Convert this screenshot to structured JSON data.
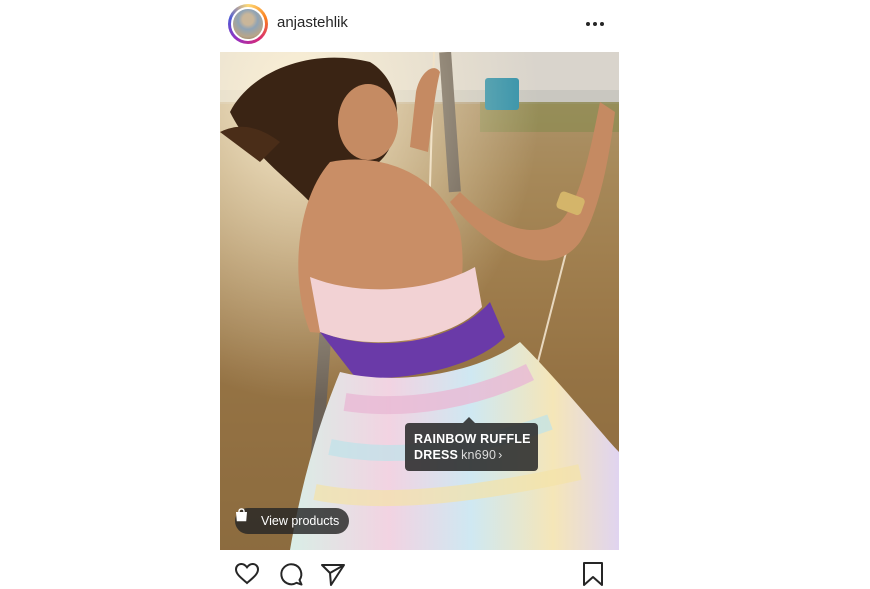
{
  "post": {
    "username": "anjastehlik",
    "product_tag": {
      "name_line1": "RAINBOW RUFFLE",
      "name_line2": "DRESS",
      "price": "kn690",
      "chevron": "›"
    },
    "view_products_label": "View products"
  },
  "icons": {
    "more": "more-options-icon",
    "like": "heart-icon",
    "comment": "comment-icon",
    "share": "paper-plane-icon",
    "save": "bookmark-icon",
    "bag": "shopping-bag-icon"
  },
  "colors": {
    "text": "#262626",
    "tag_bg": "#262626",
    "ring_start": "#feda75",
    "ring_end": "#962fbf"
  }
}
